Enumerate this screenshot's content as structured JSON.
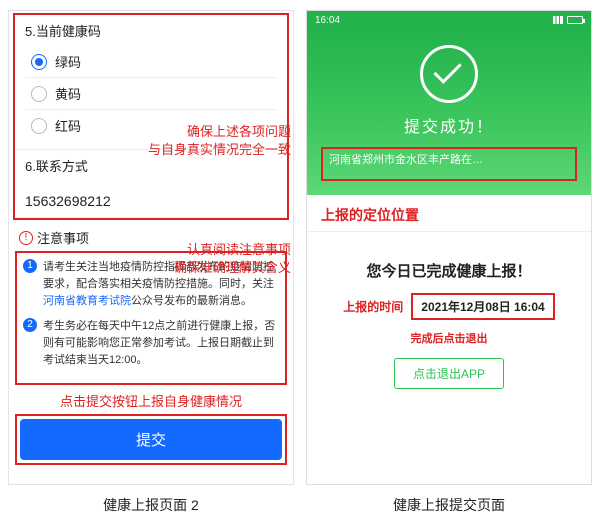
{
  "left": {
    "section5_title": "5.当前健康码",
    "options": [
      "绿码",
      "黄码",
      "红码"
    ],
    "selected_index": 0,
    "anno_match": "确保上述各项问题\n与自身真实情况完全一致",
    "section6_title": "6.联系方式",
    "phone": "15632698212",
    "notice_heading": "注意事项",
    "anno_read": "认真阅读注意事项\n确保准确理解其含义",
    "notice1_pre": "请考生关注当地疫情防控指挥部发布的疫情防控要求，配合落实相关疫情防控措施。同时，关注",
    "notice1_link": "河南省教育考试院",
    "notice1_post": "公众号发布的最新消息。",
    "notice2": "考生务必在每天中午12点之前进行健康上报，否则有可能影响您正常参加考试。上报日期截止到考试结束当天12:00。",
    "anno_submit": "点击提交按钮上报自身健康情况",
    "submit_label": "提交"
  },
  "right": {
    "status_time": "16:04",
    "success_text": "提交成功！",
    "address": "河南省郑州市金水区丰产路在…",
    "loc_label": "上报的定位位置",
    "done_title": "您今日已完成健康上报！",
    "time_label": "上报的时间",
    "time_value": "2021年12月08日 16:04",
    "exit_hint": "完成后点击退出",
    "exit_button": "点击退出APP"
  },
  "captions": {
    "left": "健康上报页面 2",
    "right": "健康上报提交页面"
  }
}
